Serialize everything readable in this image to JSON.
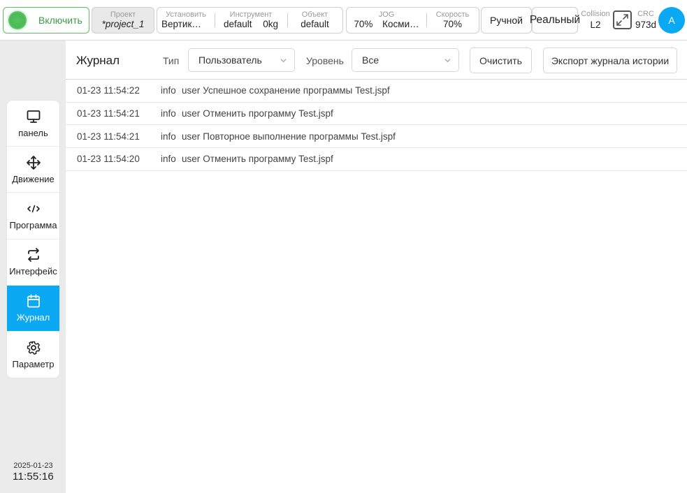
{
  "topbar": {
    "power": {
      "label": "Включить"
    },
    "project": {
      "caption": "Проект",
      "value": "*project_1"
    },
    "setup": [
      {
        "caption": "Установить",
        "value": "Вертик…"
      },
      {
        "caption": "Инструмент",
        "value": "default",
        "extra": "0kg"
      },
      {
        "caption": "Объект",
        "value": "default"
      }
    ],
    "jog": [
      {
        "caption": "JOG",
        "value": "70%",
        "extra": "Косми…"
      },
      {
        "caption": "Скорость",
        "value": "70%"
      }
    ],
    "mode_label": "Ручной",
    "env_label": "Реальный",
    "collision": {
      "caption": "Collision",
      "value": "L2"
    },
    "crc": {
      "caption": "CRC",
      "value": "973d"
    },
    "avatar_letter": "A"
  },
  "sidebar": {
    "items": [
      {
        "label": "панель",
        "icon": "monitor-icon"
      },
      {
        "label": "Движение",
        "icon": "move-icon"
      },
      {
        "label": "Программа",
        "icon": "code-icon"
      },
      {
        "label": "Интерфейс",
        "icon": "swap-icon"
      },
      {
        "label": "Журнал",
        "icon": "calendar-icon",
        "active": true
      },
      {
        "label": "Параметр",
        "icon": "gear-icon"
      }
    ],
    "date": "2025-01-23",
    "time": "11:55:16"
  },
  "journal": {
    "title": "Журнал",
    "type_label": "Тип",
    "type_value": "Пользователь",
    "level_label": "Уровень",
    "level_value": "Все",
    "clear_label": "Очистить",
    "export_label": "Экспорт журнала истории",
    "rows": [
      {
        "time": "01-23 11:54:22",
        "level": "info",
        "user": "user",
        "message": "Успешное сохранение программы Test.jspf"
      },
      {
        "time": "01-23 11:54:21",
        "level": "info",
        "user": "user",
        "message": "Отменить программу Test.jspf"
      },
      {
        "time": "01-23 11:54:21",
        "level": "info",
        "user": "user",
        "message": "Повторное выполнение программы Test.jspf"
      },
      {
        "time": "01-23 11:54:20",
        "level": "info",
        "user": "user",
        "message": "Отменить программу Test.jspf"
      }
    ]
  },
  "colors": {
    "accent": "#0ba8f4",
    "power_green": "#4cb956"
  }
}
